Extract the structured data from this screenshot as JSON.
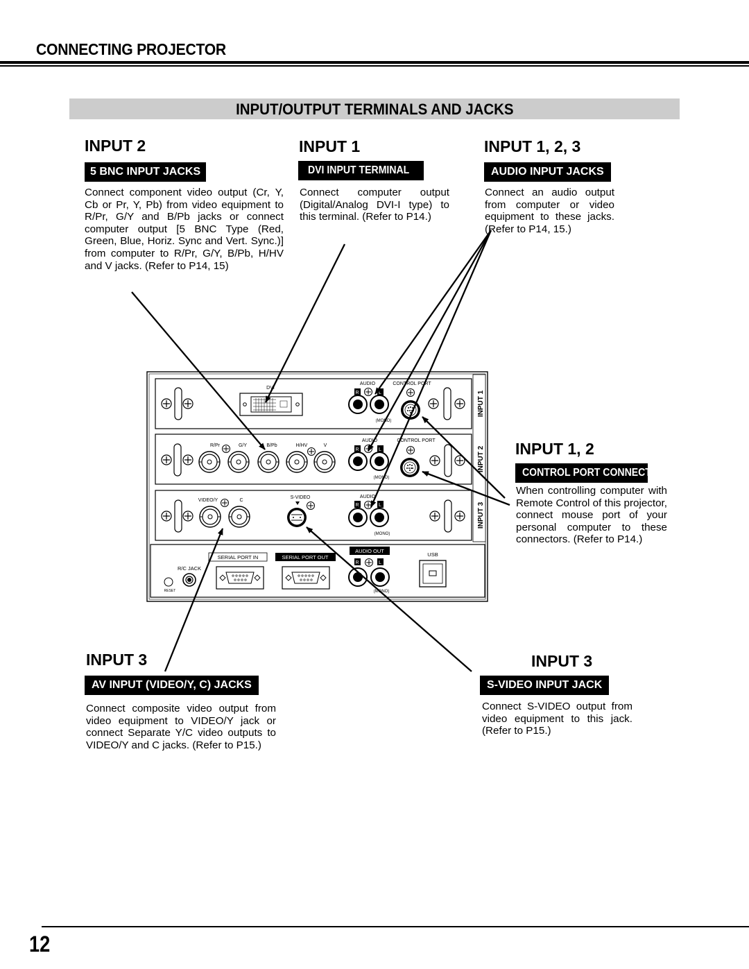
{
  "chapter_title": "CONNECTING PROJECTOR",
  "section_banner": "INPUT/OUTPUT TERMINALS AND JACKS",
  "callouts": {
    "bnc": {
      "heading": "INPUT 2",
      "tag": "5 BNC INPUT JACKS",
      "text": "Connect component video output (Cr, Y, Cb or Pr, Y, Pb) from video equipment to R/Pr, G/Y and B/Pb jacks or connect computer output [5 BNC Type (Red, Green, Blue, Horiz. Sync and Vert. Sync.)] from computer to R/Pr, G/Y, B/Pb, H/HV and V jacks. (Refer to P14, 15)"
    },
    "dvi": {
      "heading": "INPUT 1",
      "tag": "DVI INPUT TERMINAL",
      "text": "Connect computer output (Digital/Analog DVI-I type) to this terminal. (Refer to P14.)"
    },
    "audio": {
      "heading": "INPUT 1, 2, 3",
      "tag": "AUDIO INPUT JACKS",
      "text": "Connect an audio output from computer or video equipment to these jacks. (Refer to P14, 15.)"
    },
    "control": {
      "heading": "INPUT 1, 2",
      "tag": "CONTROL PORT CONNECTORS",
      "text": "When controlling computer with Remote Control of this projector, connect mouse port of your personal computer to these connectors. (Refer to P14.)"
    },
    "av": {
      "heading": "INPUT 3",
      "tag": "AV INPUT (VIDEO/Y, C) JACKS",
      "text": "Connect composite video output from video equipment to VIDEO/Y jack or connect Separate Y/C video outputs to VIDEO/Y and C jacks. (Refer to P15.)"
    },
    "svideo": {
      "heading": "INPUT 3",
      "tag": "S-VIDEO INPUT JACK",
      "text": "Connect S-VIDEO output from video equipment to this jack. (Refer to P15.)"
    }
  },
  "panel": {
    "input1": {
      "side_label": "INPUT 1",
      "dvi": "DVI",
      "audio": "AUDIO",
      "control_port": "CONTROL PORT",
      "r": "R",
      "l": "L",
      "mono": "(MONO)"
    },
    "input2": {
      "side_label": "INPUT 2",
      "bnc_labels": [
        "R/Pr",
        "G/Y",
        "B/Pb",
        "H/HV",
        "V"
      ],
      "audio": "AUDIO",
      "control_port": "CONTROL PORT",
      "r": "R",
      "l": "L",
      "mono": "(MONO)"
    },
    "input3": {
      "side_label": "INPUT 3",
      "video_y": "VIDEO/Y",
      "c": "C",
      "svideo": "S-VIDEO",
      "audio": "AUDIO",
      "r": "R",
      "l": "L",
      "mono": "(MONO)"
    },
    "bottom": {
      "serial_in": "SERIAL PORT IN",
      "serial_out": "SERIAL PORT OUT",
      "audio_out": "AUDIO OUT",
      "usb": "USB",
      "rc_jack": "R/C JACK",
      "reset": "RESET",
      "r": "R",
      "l": "L",
      "mono": "(MONO)"
    }
  },
  "page_number": "12"
}
